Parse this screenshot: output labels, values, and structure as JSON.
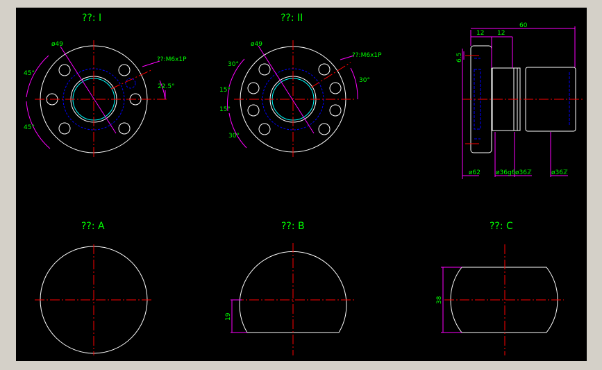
{
  "colors": {
    "background": "#000000",
    "frame": "#d4d0c8",
    "geometry": "#ffffff",
    "center_line": "#ff0000",
    "dimension": "#ff00ff",
    "text": "#00ff00",
    "hidden": "#0000ff",
    "highlight": "#00ffff"
  },
  "views": {
    "view_1": {
      "title": "??: I",
      "dia_label": "ø49",
      "thread_label": "??:M6x1P",
      "angle_top": "45°",
      "angle_bottom": "45°",
      "angle_right": "22.5°"
    },
    "view_2": {
      "title": "??: II",
      "dia_label": "ø49",
      "thread_label": "??:M6x1P",
      "angle_top": "30°",
      "angle_upper_mid": "15°",
      "angle_lower_mid": "15°",
      "angle_bottom": "30°",
      "angle_right": "30°"
    },
    "side_view": {
      "dim_total": "60",
      "dim_flange": "12",
      "dim_neck": "12",
      "dim_small": "6.5",
      "dia_flange": "ø62",
      "dia_fit": "ø36g6",
      "dia_body": "ø36ℤ",
      "dia_end": "ø36ℤ"
    },
    "view_a": {
      "title": "??: A"
    },
    "view_b": {
      "title": "??: B",
      "dim_height": "19"
    },
    "view_c": {
      "title": "??: C",
      "dim_width": "38"
    }
  }
}
